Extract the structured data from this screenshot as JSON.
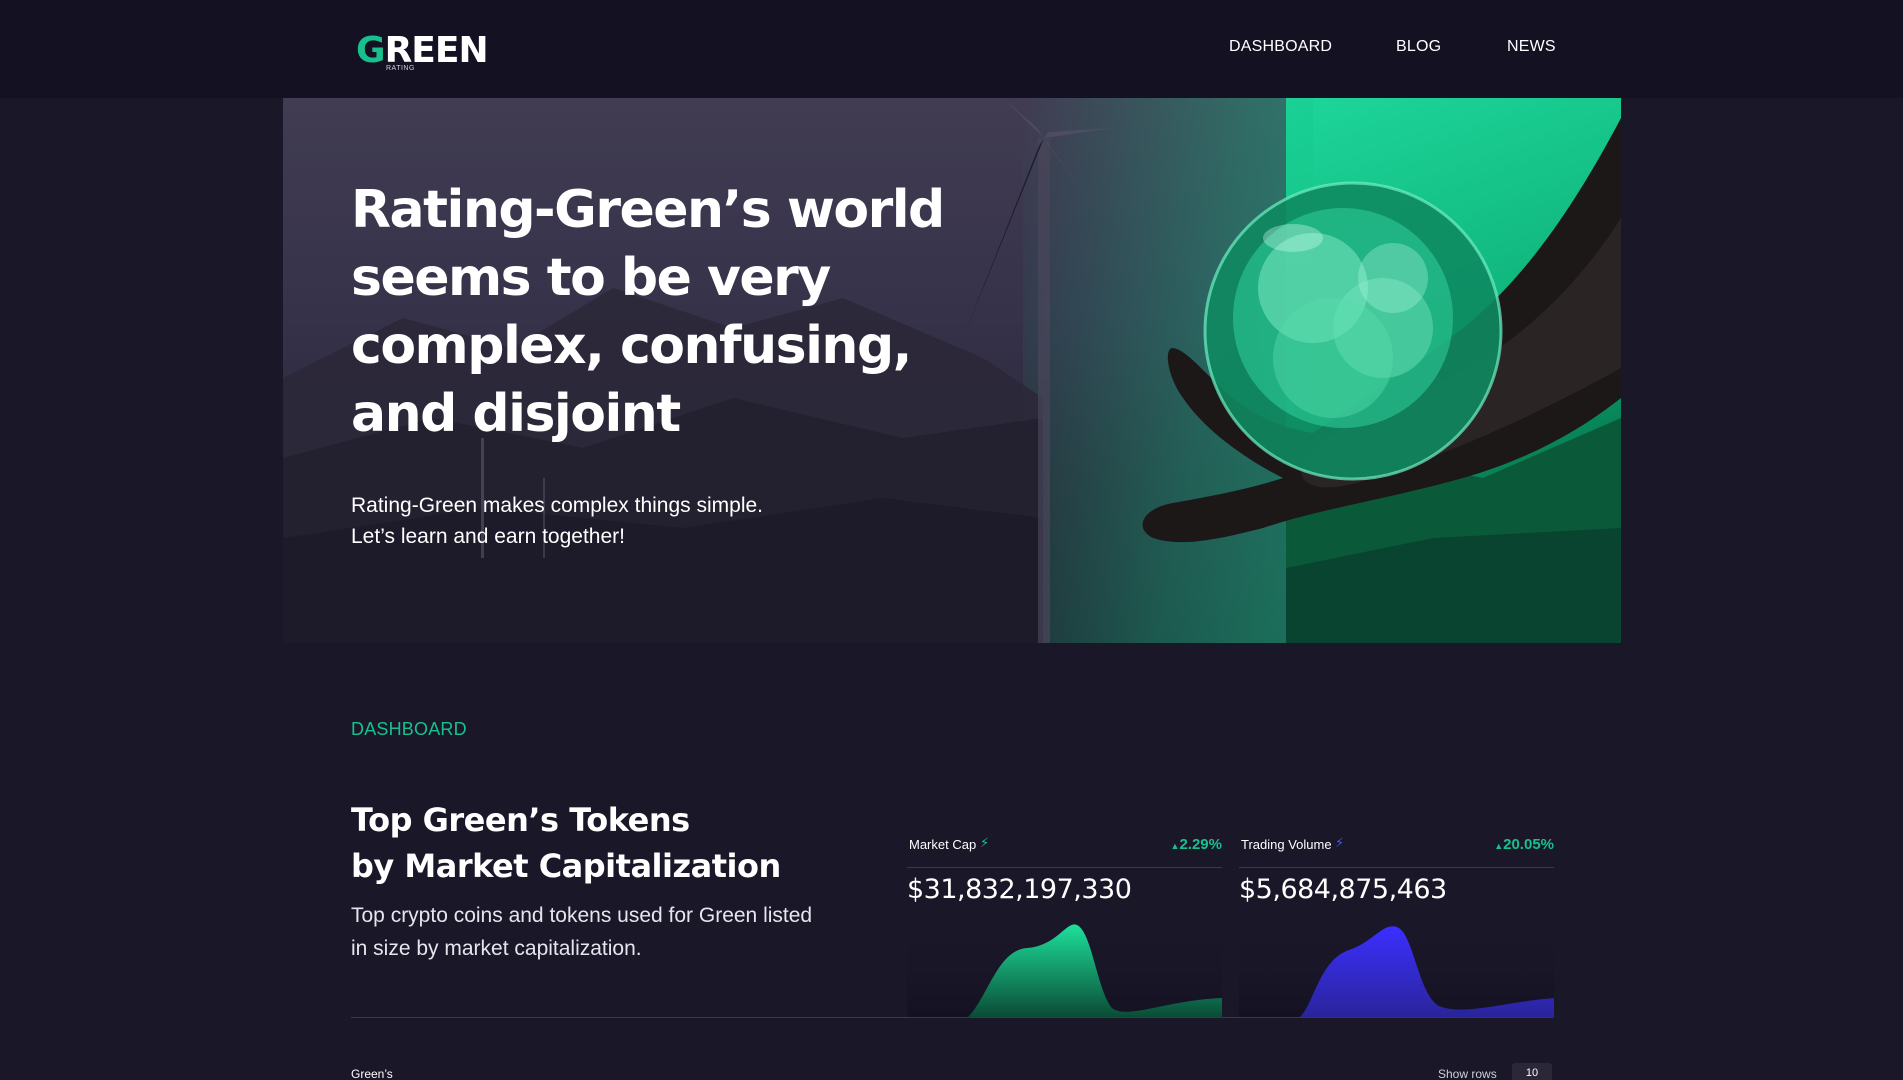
{
  "header": {
    "logo_text": "GREEN",
    "logo_sub": "RATING",
    "nav": [
      "DASHBOARD",
      "BLOG",
      "NEWS"
    ]
  },
  "hero": {
    "title": "Rating-Green’s world seems to be very complex, confusing, and disjoint",
    "subtitle_line1": "Rating-Green makes complex things simple.",
    "subtitle_line2": "Let’s learn and earn together!"
  },
  "dashboard": {
    "section_label": "DASHBOARD",
    "title_line1": "Top Green’s Tokens",
    "title_line2": "by Market Capitalization",
    "description": "Top crypto coins and tokens used for Green listed in size by market capitalization.",
    "cards": [
      {
        "label": "Market Cap",
        "icon": "lightning-icon",
        "change": "2.29%",
        "value": "$31,832,197,330",
        "color": "#18c08d"
      },
      {
        "label": "Trading Volume",
        "icon": "lightning-icon",
        "change": "20.05%",
        "value": "$5,684,875,463",
        "color": "#3b2fe0"
      }
    ],
    "table": {
      "left_label": "Green’s",
      "show_rows_label": "Show rows",
      "rows_value": "10"
    }
  },
  "colors": {
    "accent": "#18c08d",
    "background": "#1a1729",
    "header": "#141222",
    "volume": "#3b2fe0"
  }
}
